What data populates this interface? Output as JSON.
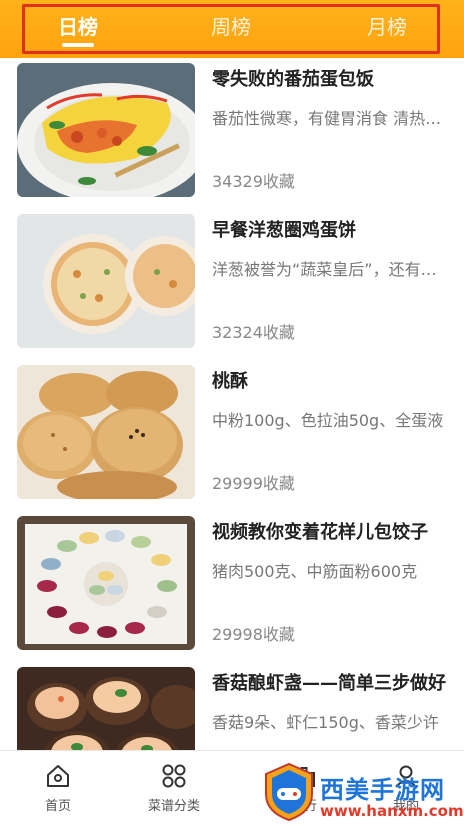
{
  "tabs": [
    {
      "label": "日榜",
      "active": true
    },
    {
      "label": "周榜",
      "active": false
    },
    {
      "label": "月榜",
      "active": false
    }
  ],
  "recipes": [
    {
      "title": "零失败的番茄蛋包饭",
      "desc": "番茄性微寒，有健胃消食 清热解毒",
      "favorites": "34329收藏",
      "image": "omelette-rice"
    },
    {
      "title": "早餐洋葱圈鸡蛋饼",
      "desc": "洋葱被誉为“蔬菜皇后”，还有降血脂",
      "favorites": "32324收藏",
      "image": "onion-egg-pancake"
    },
    {
      "title": "桃酥",
      "desc": "中粉100g、色拉油50g、全蛋液",
      "favorites": "29999收藏",
      "image": "walnut-cookies"
    },
    {
      "title": "视频教你变着花样儿包饺子",
      "desc": "猪肉500克、中筋面粉600克",
      "favorites": "29998收藏",
      "image": "dumplings"
    },
    {
      "title": "香菇酿虾盏——简单三步做好",
      "desc": "香菇9朵、虾仁150g、香菜少许",
      "favorites": "",
      "image": "stuffed-mushrooms"
    }
  ],
  "bottom_nav": [
    {
      "label": "首页",
      "icon": "home-icon"
    },
    {
      "label": "菜谱分类",
      "icon": "grid-icon"
    },
    {
      "label": "排行",
      "icon": "rank-icon"
    },
    {
      "label": "我的",
      "icon": "user-icon"
    }
  ],
  "watermark": {
    "title": "西美手游网",
    "url": "www.hanxm.com"
  },
  "colors": {
    "accent": "#ffa30f",
    "highlight_border": "#e0301e"
  }
}
